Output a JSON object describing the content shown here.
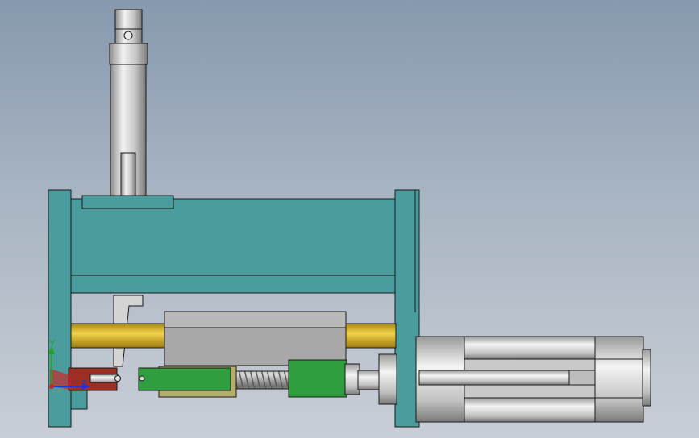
{
  "colors": {
    "frame": "#4b9c9c",
    "frame_dark": "#3f8a8a",
    "rod": "#d8b21e",
    "block_gray": "#aeaeae",
    "green_part": "#2e9e3e",
    "olive_part": "#b3ae6a",
    "red_part": "#9c2e24",
    "cylinder_light": "#e6e6e6",
    "cylinder_dark": "#8a8a8a",
    "outline": "#1a1a1a"
  },
  "triad": {
    "x_label": "X",
    "y_label": "Y",
    "z_label": "Z",
    "x_color": "#1f35d6",
    "y_color": "#1fa51f",
    "z_color": "#d21f1f"
  }
}
